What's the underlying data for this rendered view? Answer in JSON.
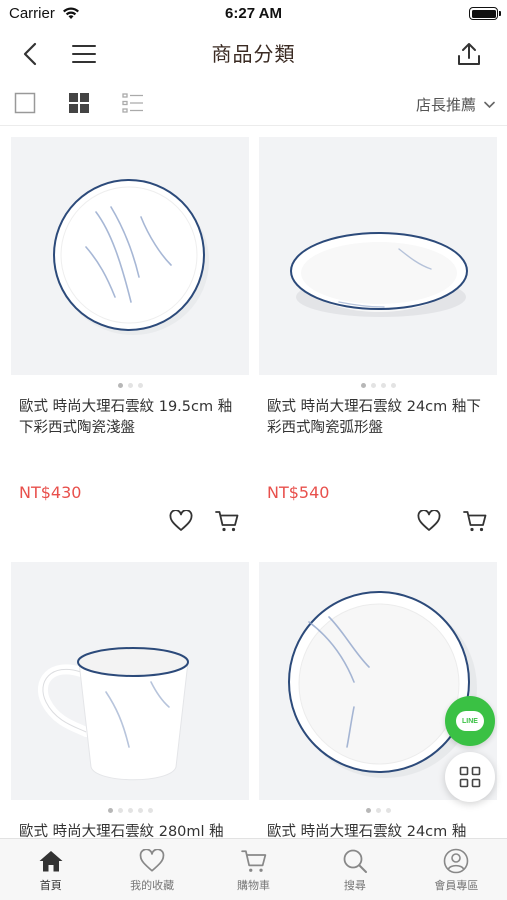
{
  "status": {
    "carrier": "Carrier",
    "time": "6:27 AM",
    "battery_level": 1.0
  },
  "header": {
    "title": "商品分類"
  },
  "toolbar": {
    "sort_label": "店長推薦"
  },
  "products": [
    {
      "name": "歐式 時尚大理石雲紋 19.5cm 釉下彩西式陶瓷淺盤",
      "price": "NT$430",
      "image": "flat-plate",
      "image_count": 3,
      "active_image": 0
    },
    {
      "name": "歐式 時尚大理石雲紋 24cm 釉下彩西式陶瓷弧形盤",
      "price": "NT$540",
      "image": "curved-bowl-plate",
      "image_count": 4,
      "active_image": 0
    },
    {
      "name": "歐式 時尚大理石雲紋 280ml 釉",
      "price": "",
      "image": "mug",
      "image_count": 5,
      "active_image": 0
    },
    {
      "name": "歐式 時尚大理石雲紋 24cm 釉",
      "price": "",
      "image": "deep-plate",
      "image_count": 3,
      "active_image": 0
    }
  ],
  "floating": {
    "line_label": "LINE"
  },
  "tabs": [
    {
      "label": "首頁",
      "icon": "home-icon",
      "active": true
    },
    {
      "label": "我的收藏",
      "icon": "heart-icon",
      "active": false
    },
    {
      "label": "購物車",
      "icon": "cart-icon",
      "active": false
    },
    {
      "label": "搜尋",
      "icon": "search-icon",
      "active": false
    },
    {
      "label": "會員專區",
      "icon": "user-icon",
      "active": false
    }
  ],
  "colors": {
    "price": "#e8504c",
    "title": "#3a2a22",
    "line_green": "#3ac144",
    "accent_blue": "#2c4a7a"
  }
}
